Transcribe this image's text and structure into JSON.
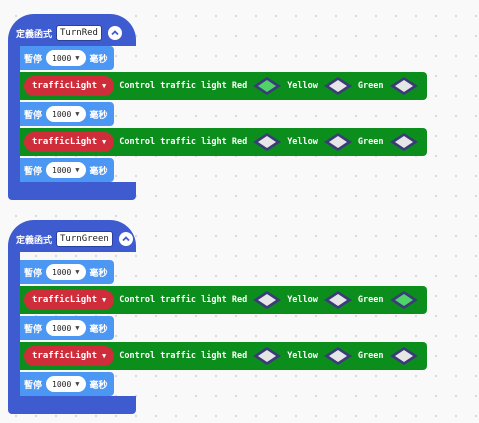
{
  "labels": {
    "define": "定義函式",
    "pause": "暫停",
    "ms": "毫秒",
    "control_text": "Control traffic light Red",
    "yellow": "Yellow",
    "green": "Green",
    "device": "trafficLight"
  },
  "colors": {
    "function_block": "#3f5bd0",
    "pause_block": "#4d97f4",
    "traffic_block": "#0c8e1c",
    "device_dropdown": "#cf2d3a",
    "lamp_on": "#50d46a",
    "lamp_off": "#e6e6e6"
  },
  "functions": [
    {
      "name": "TurnRed",
      "pause1": "1000",
      "light1": {
        "red": true,
        "yellow": false,
        "green": false
      },
      "pause2": "1000",
      "light2": {
        "red": false,
        "yellow": false,
        "green": false
      },
      "pause3": "1000"
    },
    {
      "name": "TurnGreen",
      "pause1": "1000",
      "light1": {
        "red": false,
        "yellow": false,
        "green": true
      },
      "pause2": "1000",
      "light2": {
        "red": false,
        "yellow": false,
        "green": false
      },
      "pause3": "1000"
    }
  ]
}
